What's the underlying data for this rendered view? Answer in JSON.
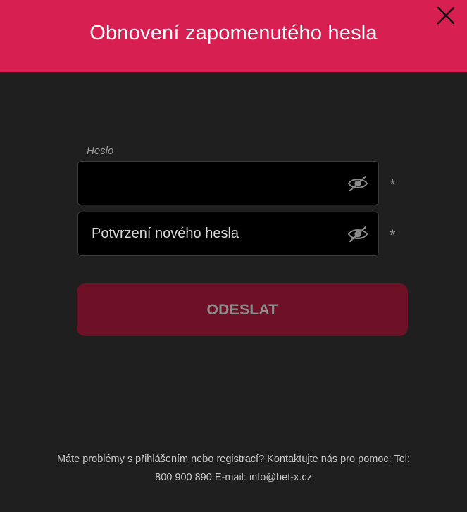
{
  "dialog": {
    "title": "Obnovení zapomenutého hesla",
    "close_icon": "close-icon"
  },
  "form": {
    "password": {
      "label": "Heslo",
      "value": "",
      "placeholder": "",
      "required_mark": "*",
      "toggle_icon": "eye-slash-icon"
    },
    "confirm": {
      "value": "",
      "placeholder": "Potvrzení nového hesla",
      "required_mark": "*",
      "toggle_icon": "eye-slash-icon"
    },
    "submit_label": "ODESLAT"
  },
  "footer": {
    "line1": "Máte problémy s přihlášením nebo registrací? Kontaktujte nás pro pomoc: Tel:",
    "line2": "800 900 890 E-mail: info@bet-x.cz"
  },
  "colors": {
    "header": "#d81f52",
    "background": "#1f1f1f",
    "input_bg": "#000000",
    "button_disabled": "#6e1026"
  }
}
